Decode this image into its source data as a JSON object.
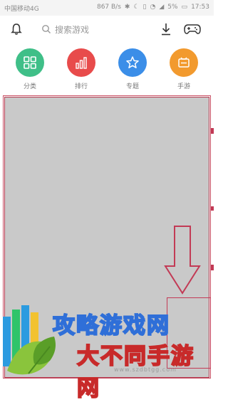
{
  "status_bar": {
    "carrier": "中国移动4G",
    "network_speed": "867 B/s",
    "battery": "5%",
    "time": "17:53"
  },
  "top_bar": {
    "search_placeholder": "搜索游戏"
  },
  "categories": [
    {
      "label": "分类",
      "icon": "grid-icon",
      "color": "#3fbf88"
    },
    {
      "label": "排行",
      "icon": "bar-chart-icon",
      "color": "#e84b4b"
    },
    {
      "label": "专题",
      "icon": "star-icon",
      "color": "#3b8ee8"
    },
    {
      "label": "手游",
      "icon": "game-box-icon",
      "color": "#f29a2e"
    }
  ],
  "watermark": {
    "line1": "攻略游戏网",
    "line2": "大不同手游网",
    "url": "www.szdbtgg.com"
  },
  "colors": {
    "content_gray": "#c9c9c9",
    "annotation_red": "#c23a55"
  }
}
